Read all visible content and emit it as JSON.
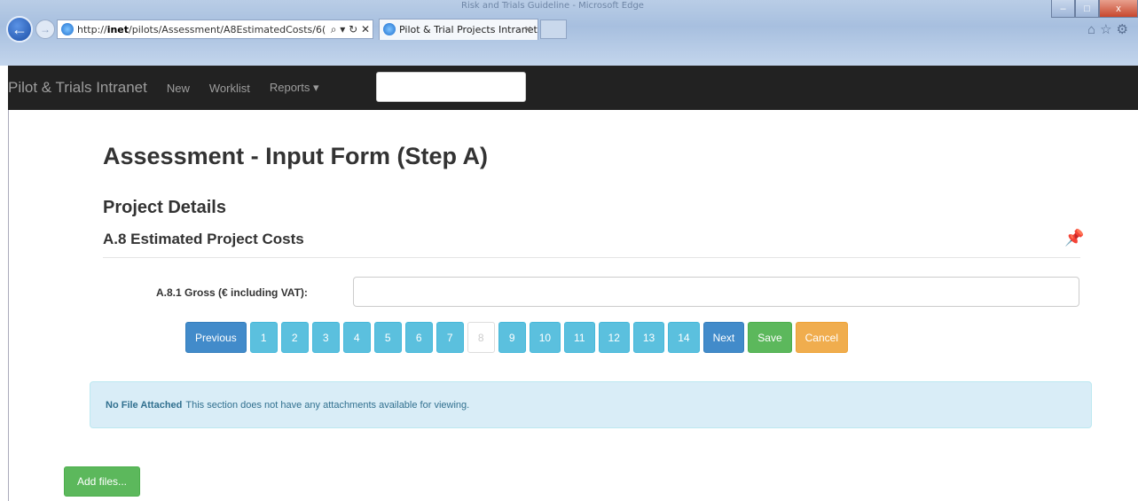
{
  "browser": {
    "window_title": "Risk and Trials Guideline - Microsoft Edge",
    "address": {
      "prefix": "http://",
      "host": "inet",
      "path": "/pilots/Assessment/A8EstimatedCosts/6(",
      "tools": "⌕ ▾ ↻ ✕"
    },
    "tab_title": "Pilot & Trial Projects Intranet",
    "tab_close": "×",
    "window_buttons": [
      "–",
      "□",
      "x"
    ],
    "right_icons": "⌂☆⚙"
  },
  "navbar": {
    "brand": "Pilot & Trials Intranet",
    "items": [
      "New",
      "Worklist",
      "Reports ▾"
    ]
  },
  "page": {
    "title": "Assessment - Input Form (Step A)",
    "section": "Project Details",
    "subsection": "A.8 Estimated Project Costs",
    "pin_icon": "★"
  },
  "form": {
    "gross_label": "A.8.1 Gross (€ including VAT):",
    "gross_value": ""
  },
  "pager": {
    "previous": "Previous",
    "pages": [
      "1",
      "2",
      "3",
      "4",
      "5",
      "6",
      "7",
      "8",
      "9",
      "10",
      "11",
      "12",
      "13",
      "14"
    ],
    "current_page": "8",
    "next": "Next",
    "save": "Save",
    "cancel": "Cancel"
  },
  "attachments": {
    "status_bold": "No File Attached",
    "status_text": "This section does not have any attachments available for viewing.",
    "add_button": "Add files..."
  }
}
